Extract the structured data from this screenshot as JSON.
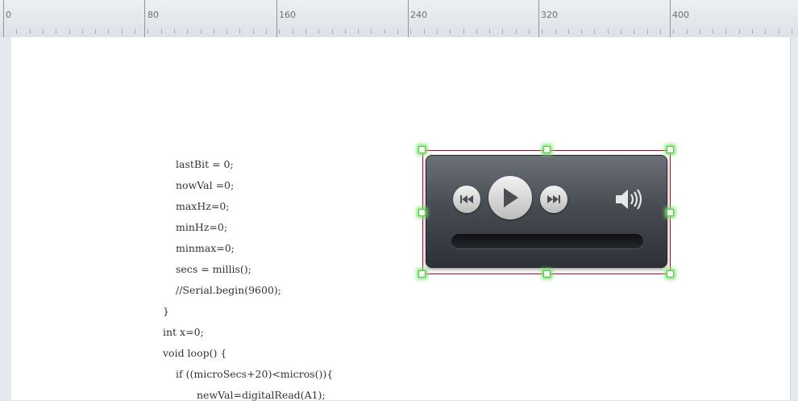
{
  "ruler": {
    "labels": [
      "0",
      "80",
      "160",
      "240",
      "320",
      "400"
    ]
  },
  "code": {
    "lines": [
      "lastBit = 0;",
      "nowVal =0;",
      "maxHz=0;",
      "minHz=0;",
      "minmax=0;",
      "secs = millis();",
      "//Serial.begin(9600);",
      "}",
      "int x=0;",
      "void loop() {",
      "if ((microSecs+20)<micros()){",
      "newVal=digitalRead(A1);"
    ]
  },
  "player": {
    "controls": [
      "rewind-icon",
      "play-icon",
      "fast-forward-icon",
      "speaker-icon"
    ],
    "accent": "#c2001a",
    "handle_color": "#51c84a"
  }
}
